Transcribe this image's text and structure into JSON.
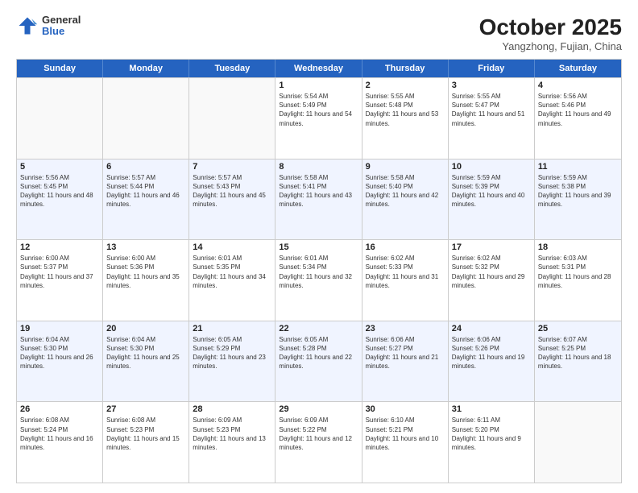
{
  "logo": {
    "general": "General",
    "blue": "Blue"
  },
  "title": "October 2025",
  "subtitle": "Yangzhong, Fujian, China",
  "days_of_week": [
    "Sunday",
    "Monday",
    "Tuesday",
    "Wednesday",
    "Thursday",
    "Friday",
    "Saturday"
  ],
  "weeks": [
    [
      {
        "date": "",
        "sunrise": "",
        "sunset": "",
        "daylight": ""
      },
      {
        "date": "",
        "sunrise": "",
        "sunset": "",
        "daylight": ""
      },
      {
        "date": "",
        "sunrise": "",
        "sunset": "",
        "daylight": ""
      },
      {
        "date": "1",
        "sunrise": "Sunrise: 5:54 AM",
        "sunset": "Sunset: 5:49 PM",
        "daylight": "Daylight: 11 hours and 54 minutes."
      },
      {
        "date": "2",
        "sunrise": "Sunrise: 5:55 AM",
        "sunset": "Sunset: 5:48 PM",
        "daylight": "Daylight: 11 hours and 53 minutes."
      },
      {
        "date": "3",
        "sunrise": "Sunrise: 5:55 AM",
        "sunset": "Sunset: 5:47 PM",
        "daylight": "Daylight: 11 hours and 51 minutes."
      },
      {
        "date": "4",
        "sunrise": "Sunrise: 5:56 AM",
        "sunset": "Sunset: 5:46 PM",
        "daylight": "Daylight: 11 hours and 49 minutes."
      }
    ],
    [
      {
        "date": "5",
        "sunrise": "Sunrise: 5:56 AM",
        "sunset": "Sunset: 5:45 PM",
        "daylight": "Daylight: 11 hours and 48 minutes."
      },
      {
        "date": "6",
        "sunrise": "Sunrise: 5:57 AM",
        "sunset": "Sunset: 5:44 PM",
        "daylight": "Daylight: 11 hours and 46 minutes."
      },
      {
        "date": "7",
        "sunrise": "Sunrise: 5:57 AM",
        "sunset": "Sunset: 5:43 PM",
        "daylight": "Daylight: 11 hours and 45 minutes."
      },
      {
        "date": "8",
        "sunrise": "Sunrise: 5:58 AM",
        "sunset": "Sunset: 5:41 PM",
        "daylight": "Daylight: 11 hours and 43 minutes."
      },
      {
        "date": "9",
        "sunrise": "Sunrise: 5:58 AM",
        "sunset": "Sunset: 5:40 PM",
        "daylight": "Daylight: 11 hours and 42 minutes."
      },
      {
        "date": "10",
        "sunrise": "Sunrise: 5:59 AM",
        "sunset": "Sunset: 5:39 PM",
        "daylight": "Daylight: 11 hours and 40 minutes."
      },
      {
        "date": "11",
        "sunrise": "Sunrise: 5:59 AM",
        "sunset": "Sunset: 5:38 PM",
        "daylight": "Daylight: 11 hours and 39 minutes."
      }
    ],
    [
      {
        "date": "12",
        "sunrise": "Sunrise: 6:00 AM",
        "sunset": "Sunset: 5:37 PM",
        "daylight": "Daylight: 11 hours and 37 minutes."
      },
      {
        "date": "13",
        "sunrise": "Sunrise: 6:00 AM",
        "sunset": "Sunset: 5:36 PM",
        "daylight": "Daylight: 11 hours and 35 minutes."
      },
      {
        "date": "14",
        "sunrise": "Sunrise: 6:01 AM",
        "sunset": "Sunset: 5:35 PM",
        "daylight": "Daylight: 11 hours and 34 minutes."
      },
      {
        "date": "15",
        "sunrise": "Sunrise: 6:01 AM",
        "sunset": "Sunset: 5:34 PM",
        "daylight": "Daylight: 11 hours and 32 minutes."
      },
      {
        "date": "16",
        "sunrise": "Sunrise: 6:02 AM",
        "sunset": "Sunset: 5:33 PM",
        "daylight": "Daylight: 11 hours and 31 minutes."
      },
      {
        "date": "17",
        "sunrise": "Sunrise: 6:02 AM",
        "sunset": "Sunset: 5:32 PM",
        "daylight": "Daylight: 11 hours and 29 minutes."
      },
      {
        "date": "18",
        "sunrise": "Sunrise: 6:03 AM",
        "sunset": "Sunset: 5:31 PM",
        "daylight": "Daylight: 11 hours and 28 minutes."
      }
    ],
    [
      {
        "date": "19",
        "sunrise": "Sunrise: 6:04 AM",
        "sunset": "Sunset: 5:30 PM",
        "daylight": "Daylight: 11 hours and 26 minutes."
      },
      {
        "date": "20",
        "sunrise": "Sunrise: 6:04 AM",
        "sunset": "Sunset: 5:30 PM",
        "daylight": "Daylight: 11 hours and 25 minutes."
      },
      {
        "date": "21",
        "sunrise": "Sunrise: 6:05 AM",
        "sunset": "Sunset: 5:29 PM",
        "daylight": "Daylight: 11 hours and 23 minutes."
      },
      {
        "date": "22",
        "sunrise": "Sunrise: 6:05 AM",
        "sunset": "Sunset: 5:28 PM",
        "daylight": "Daylight: 11 hours and 22 minutes."
      },
      {
        "date": "23",
        "sunrise": "Sunrise: 6:06 AM",
        "sunset": "Sunset: 5:27 PM",
        "daylight": "Daylight: 11 hours and 21 minutes."
      },
      {
        "date": "24",
        "sunrise": "Sunrise: 6:06 AM",
        "sunset": "Sunset: 5:26 PM",
        "daylight": "Daylight: 11 hours and 19 minutes."
      },
      {
        "date": "25",
        "sunrise": "Sunrise: 6:07 AM",
        "sunset": "Sunset: 5:25 PM",
        "daylight": "Daylight: 11 hours and 18 minutes."
      }
    ],
    [
      {
        "date": "26",
        "sunrise": "Sunrise: 6:08 AM",
        "sunset": "Sunset: 5:24 PM",
        "daylight": "Daylight: 11 hours and 16 minutes."
      },
      {
        "date": "27",
        "sunrise": "Sunrise: 6:08 AM",
        "sunset": "Sunset: 5:23 PM",
        "daylight": "Daylight: 11 hours and 15 minutes."
      },
      {
        "date": "28",
        "sunrise": "Sunrise: 6:09 AM",
        "sunset": "Sunset: 5:23 PM",
        "daylight": "Daylight: 11 hours and 13 minutes."
      },
      {
        "date": "29",
        "sunrise": "Sunrise: 6:09 AM",
        "sunset": "Sunset: 5:22 PM",
        "daylight": "Daylight: 11 hours and 12 minutes."
      },
      {
        "date": "30",
        "sunrise": "Sunrise: 6:10 AM",
        "sunset": "Sunset: 5:21 PM",
        "daylight": "Daylight: 11 hours and 10 minutes."
      },
      {
        "date": "31",
        "sunrise": "Sunrise: 6:11 AM",
        "sunset": "Sunset: 5:20 PM",
        "daylight": "Daylight: 11 hours and 9 minutes."
      },
      {
        "date": "",
        "sunrise": "",
        "sunset": "",
        "daylight": ""
      }
    ]
  ]
}
